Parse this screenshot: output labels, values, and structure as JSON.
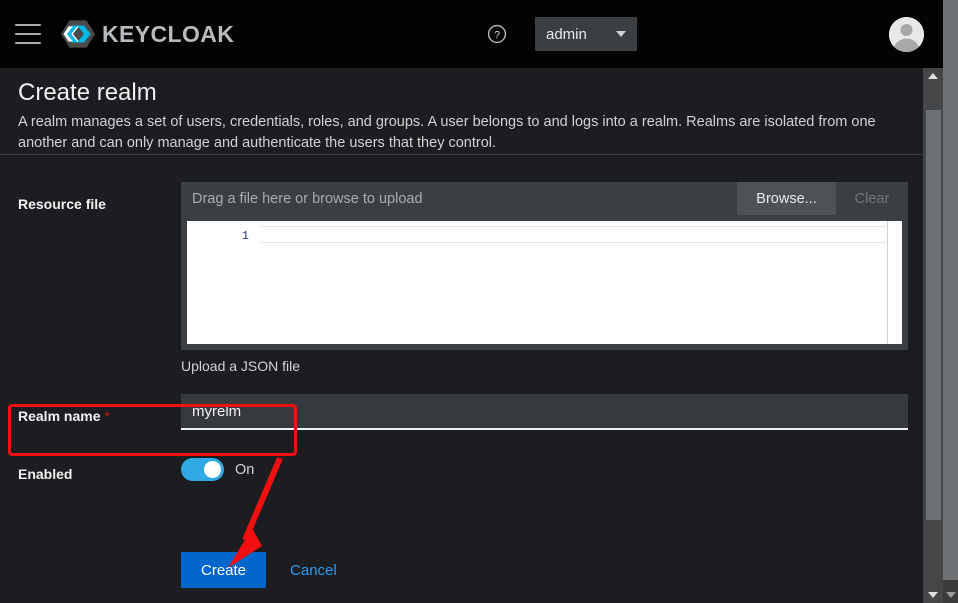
{
  "masthead": {
    "menu_icon": "hamburger-menu-icon",
    "brand_name": "KEYCLOAK",
    "help_icon": "question-circle-icon",
    "user_menu_label": "admin",
    "caret_icon": "caret-down-icon",
    "avatar_icon": "user-avatar-icon",
    "background": "#030303"
  },
  "page": {
    "title": "Create realm",
    "description": "A realm manages a set of users, credentials, roles, and groups. A user belongs to and logs into a realm. Realms are isolated from one another and can only manage and authenticate the users that they control."
  },
  "form": {
    "resource_file": {
      "label": "Resource file",
      "placeholder": "Drag a file here or browse to upload",
      "value": "",
      "browse_label": "Browse...",
      "clear_label": "Clear",
      "clear_disabled": true,
      "editor_line_number": "1",
      "editor_content": "",
      "helper_text": "Upload a JSON file"
    },
    "realm_name": {
      "label": "Realm name",
      "required_marker": "*",
      "value": "myrelm",
      "placeholder": ""
    },
    "enabled": {
      "label": "Enabled",
      "toggle_state": "On",
      "toggle_on": true,
      "toggle_color": "#2fa8e4"
    }
  },
  "actions": {
    "create_label": "Create",
    "create_color": "#0066cc",
    "cancel_label": "Cancel",
    "cancel_color": "#2b9af3"
  },
  "annotations": {
    "highlight_color": "#f10f0f",
    "highlight_target": "realm-name-field",
    "arrow_target": "create-button"
  },
  "scrollbars": {
    "inner": {
      "up_arrow": "scroll-up-icon",
      "down_arrow": "scroll-down-icon"
    },
    "outer": {
      "down_arrow": "scroll-down-icon"
    }
  }
}
